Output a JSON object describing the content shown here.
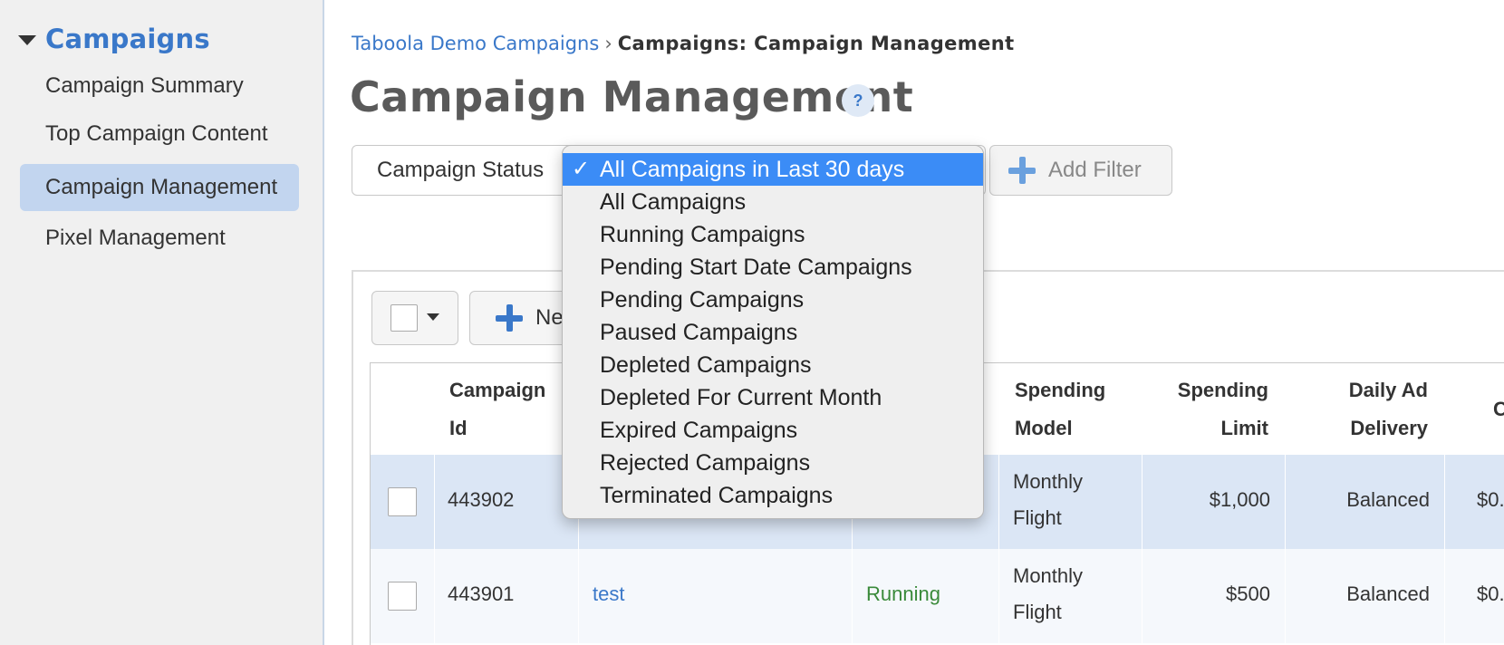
{
  "sidebar": {
    "section_title": "Campaigns",
    "items": [
      {
        "label": "Campaign Summary"
      },
      {
        "label": "Top Campaign Content"
      },
      {
        "label": "Campaign Management"
      },
      {
        "label": "Pixel Management"
      }
    ]
  },
  "breadcrumb": {
    "link": "Taboola Demo Campaigns",
    "separator": "›",
    "current": "Campaigns: Campaign Management"
  },
  "page": {
    "title": "Campaign Management",
    "help_label": "?"
  },
  "filter": {
    "label": "Campaign Status",
    "add_filter_label": "Add Filter",
    "dropdown": {
      "check_mark": "✓",
      "options": [
        "All Campaigns in Last 30 days",
        "All Campaigns",
        "Running Campaigns",
        "Pending Start Date Campaigns",
        "Pending Campaigns",
        "Paused Campaigns",
        "Depleted Campaigns",
        "Depleted For Current Month",
        "Expired Campaigns",
        "Rejected Campaigns",
        "Terminated Campaigns"
      ],
      "selected": "All Campaigns in Last 30 days"
    }
  },
  "toolbar": {
    "new_button_label": "New Campaign"
  },
  "table": {
    "headers": {
      "campaign_id_1": "Campaign",
      "campaign_id_2": "Id",
      "spending_model_1": "Spending",
      "spending_model_2": "Model",
      "spending_limit_1": "Spending",
      "spending_limit_2": "Limit",
      "daily_ad_delivery_1": "Daily Ad",
      "daily_ad_delivery_2": "Delivery",
      "cut_header": "C"
    },
    "rows": [
      {
        "id": "443902",
        "name": "",
        "status": "",
        "model_1": "Monthly",
        "model_2": "Flight",
        "limit": "$1,000",
        "delivery": "Balanced",
        "cpc": "$0."
      },
      {
        "id": "443901",
        "name": "test",
        "status": "Running",
        "model_1": "Monthly",
        "model_2": "Flight",
        "limit": "$500",
        "delivery": "Balanced",
        "cpc": "$0."
      }
    ]
  }
}
